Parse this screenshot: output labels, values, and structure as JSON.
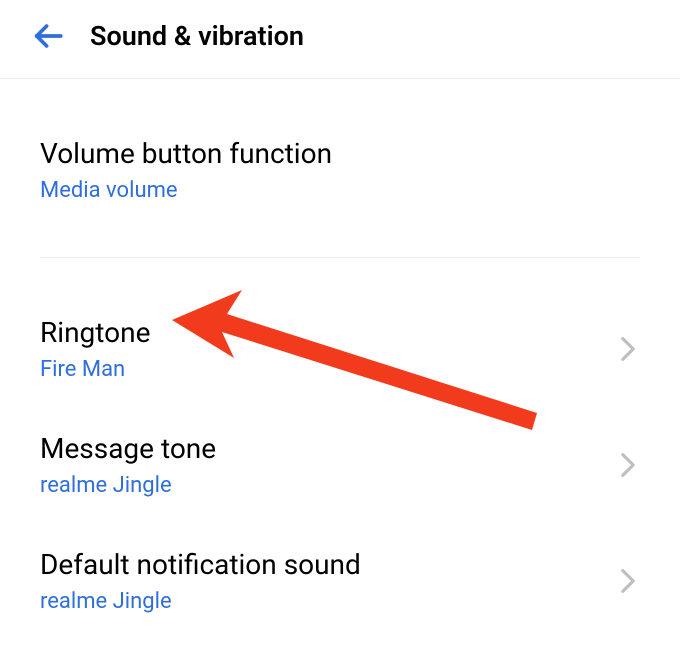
{
  "header": {
    "title": "Sound & vibration"
  },
  "settings": {
    "volume_button": {
      "label": "Volume button function",
      "value": "Media volume"
    },
    "ringtone": {
      "label": "Ringtone",
      "value": "Fire Man"
    },
    "message_tone": {
      "label": "Message tone",
      "value": "realme Jingle"
    },
    "default_notification": {
      "label": "Default notification sound",
      "value": "realme Jingle"
    }
  },
  "annotation": {
    "type": "arrow",
    "color": "#f23b1c",
    "points_to": "ringtone"
  }
}
